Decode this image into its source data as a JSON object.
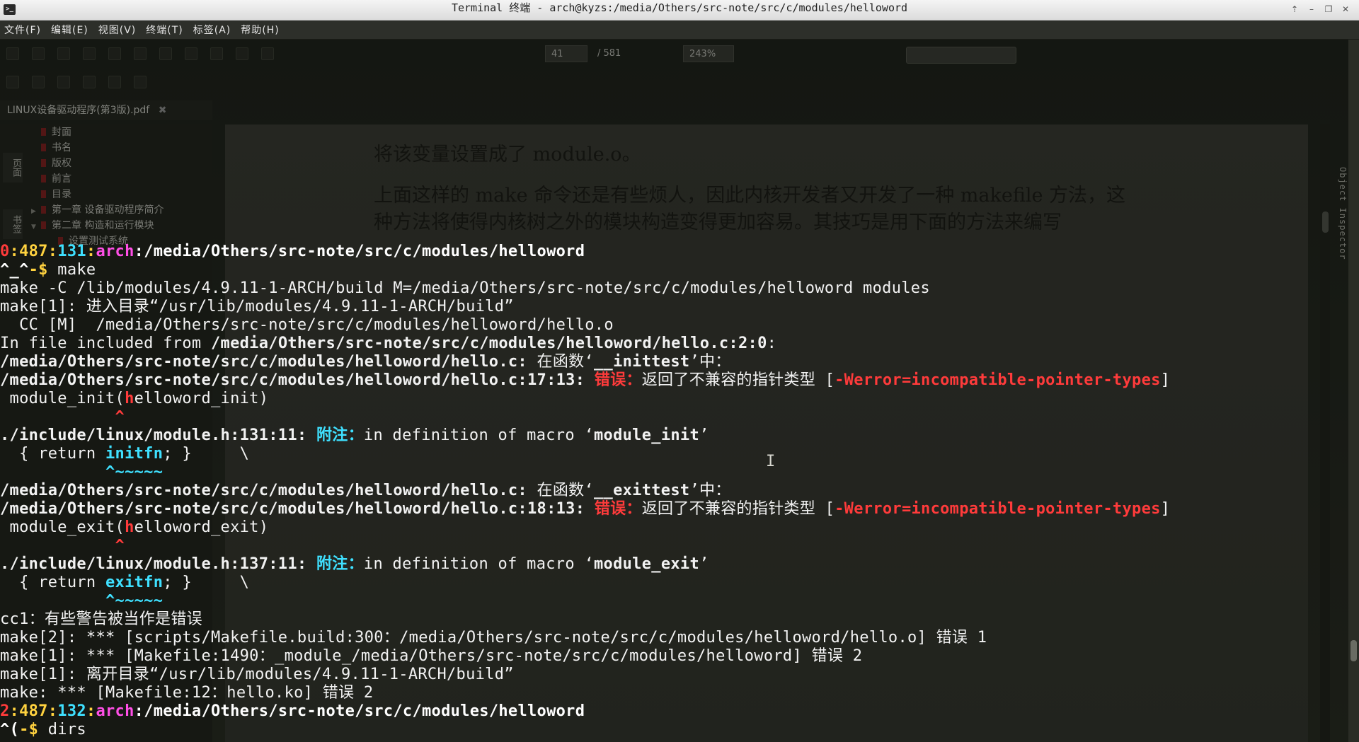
{
  "window": {
    "title": "Terminal 终端 - arch@kyzs:/media/Others/src-note/src/c/modules/helloword",
    "icon": "terminal-icon",
    "icon_glyph": ">_",
    "controls": [
      "up-icon",
      "minimize-icon",
      "maximize-icon",
      "close-icon"
    ]
  },
  "menu": [
    "文件(F)",
    "编辑(E)",
    "视图(V)",
    "终端(T)",
    "标签(A)",
    "帮助(H)"
  ],
  "viewer": {
    "page_current": "41",
    "page_total": "/ 581",
    "zoom": "243%",
    "tab_title": "LINUX设备驱动程序(第3版).pdf",
    "side_tabs": [
      "页面",
      "书签"
    ],
    "toc": [
      {
        "label": "封面",
        "level": 1
      },
      {
        "label": "书名",
        "level": 1
      },
      {
        "label": "版权",
        "level": 1
      },
      {
        "label": "前言",
        "level": 1
      },
      {
        "label": "目录",
        "level": 1
      },
      {
        "label": "第一章  设备驱动程序简介",
        "level": 1,
        "expandable": true
      },
      {
        "label": "第二章  构造和运行模块",
        "level": 1,
        "expanded": true
      },
      {
        "label": "设置测试系统",
        "level": 2
      }
    ],
    "pdf_lines": [
      "将该变量设置成了 module.o。",
      "上面这样的 make 命令还是有些烦人，因此内核开发者又开发了一种 makefile 方法，这",
      "种方法将使得内核树之外的模块构造变得更加容易。其技巧是用下面的方法来编写"
    ],
    "inspector_label": "Object Inspector"
  },
  "terminal": {
    "lines": [
      [
        {
          "t": "0",
          "c": "red",
          "b": true
        },
        {
          "t": ":487:",
          "c": "yellow",
          "b": true
        },
        {
          "t": "131",
          "c": "cyan",
          "b": true
        },
        {
          "t": ":",
          "c": "yellow",
          "b": true
        },
        {
          "t": "arch",
          "c": "magenta",
          "b": true
        },
        {
          "t": ":/media/Others/src-note/src/c/modules/helloword",
          "c": "white",
          "b": true
        }
      ],
      [
        {
          "t": "^_^",
          "c": "white",
          "b": true
        },
        {
          "t": "-$",
          "c": "yellow",
          "b": true
        },
        {
          "t": " make"
        }
      ],
      [
        {
          "t": "make -C /lib/modules/4.9.11-1-ARCH/build M=/media/Others/src-note/src/c/modules/helloword modules"
        }
      ],
      [
        {
          "t": "make[1]: 进入目录“/usr/lib/modules/4.9.11-1-ARCH/build”"
        }
      ],
      [
        {
          "t": "  CC [M]  /media/Others/src-note/src/c/modules/helloword/hello.o"
        }
      ],
      [
        {
          "t": "In file included from "
        },
        {
          "t": "/media/Others/src-note/src/c/modules/helloword/hello.c:2:0",
          "b": true
        },
        {
          "t": ":"
        }
      ],
      [
        {
          "t": "/media/Others/src-note/src/c/modules/helloword/hello.c:",
          "b": true
        },
        {
          "t": " 在函数‘"
        },
        {
          "t": "__inittest",
          "b": true
        },
        {
          "t": "’中："
        }
      ],
      [
        {
          "t": "/media/Others/src-note/src/c/modules/helloword/hello.c:17:13:",
          "b": true
        },
        {
          "t": " "
        },
        {
          "t": "错误：",
          "c": "red",
          "b": true
        },
        {
          "t": "返回了不兼容的指针类型 ["
        },
        {
          "t": "-Werror=incompatible-pointer-types",
          "c": "red",
          "b": true
        },
        {
          "t": "]"
        }
      ],
      [
        {
          "t": " module_init("
        },
        {
          "t": "h",
          "c": "red",
          "b": true
        },
        {
          "t": "elloword_init)"
        }
      ],
      [
        {
          "t": "            "
        },
        {
          "t": "^",
          "c": "red",
          "b": true
        }
      ],
      [
        {
          "t": "./include/linux/module.h:131:11:",
          "b": true
        },
        {
          "t": " "
        },
        {
          "t": "附注：",
          "c": "cyan",
          "b": true
        },
        {
          "t": "in definition of macro ‘"
        },
        {
          "t": "module_init",
          "b": true
        },
        {
          "t": "’"
        }
      ],
      [
        {
          "t": "  { return "
        },
        {
          "t": "initfn",
          "c": "cyan",
          "b": true
        },
        {
          "t": "; }     \\"
        }
      ],
      [
        {
          "t": "           "
        },
        {
          "t": "^~~~~~",
          "c": "cyan",
          "b": true
        }
      ],
      [
        {
          "t": "/media/Others/src-note/src/c/modules/helloword/hello.c:",
          "b": true
        },
        {
          "t": " 在函数‘"
        },
        {
          "t": "__exittest",
          "b": true
        },
        {
          "t": "’中："
        }
      ],
      [
        {
          "t": "/media/Others/src-note/src/c/modules/helloword/hello.c:18:13:",
          "b": true
        },
        {
          "t": " "
        },
        {
          "t": "错误：",
          "c": "red",
          "b": true
        },
        {
          "t": "返回了不兼容的指针类型 ["
        },
        {
          "t": "-Werror=incompatible-pointer-types",
          "c": "red",
          "b": true
        },
        {
          "t": "]"
        }
      ],
      [
        {
          "t": " module_exit("
        },
        {
          "t": "h",
          "c": "red",
          "b": true
        },
        {
          "t": "elloword_exit)"
        }
      ],
      [
        {
          "t": "            "
        },
        {
          "t": "^",
          "c": "red",
          "b": true
        }
      ],
      [
        {
          "t": "./include/linux/module.h:137:11:",
          "b": true
        },
        {
          "t": " "
        },
        {
          "t": "附注：",
          "c": "cyan",
          "b": true
        },
        {
          "t": "in definition of macro ‘"
        },
        {
          "t": "module_exit",
          "b": true
        },
        {
          "t": "’"
        }
      ],
      [
        {
          "t": "  { return "
        },
        {
          "t": "exitfn",
          "c": "cyan",
          "b": true
        },
        {
          "t": "; }     \\"
        }
      ],
      [
        {
          "t": "           "
        },
        {
          "t": "^~~~~~",
          "c": "cyan",
          "b": true
        }
      ],
      [
        {
          "t": "cc1：有些警告被当作是错误"
        }
      ],
      [
        {
          "t": "make[2]: *** [scripts/Makefile.build:300：/media/Others/src-note/src/c/modules/helloword/hello.o] 错误 1"
        }
      ],
      [
        {
          "t": "make[1]: *** [Makefile:1490：_module_/media/Others/src-note/src/c/modules/helloword] 错误 2"
        }
      ],
      [
        {
          "t": "make[1]: 离开目录“/usr/lib/modules/4.9.11-1-ARCH/build”"
        }
      ],
      [
        {
          "t": "make: *** [Makefile:12：hello.ko] 错误 2"
        }
      ],
      [
        {
          "t": "2",
          "c": "red",
          "b": true
        },
        {
          "t": ":487:",
          "c": "yellow",
          "b": true
        },
        {
          "t": "132",
          "c": "cyan",
          "b": true
        },
        {
          "t": ":",
          "c": "yellow",
          "b": true
        },
        {
          "t": "arch",
          "c": "magenta",
          "b": true
        },
        {
          "t": ":/media/Others/src-note/src/c/modules/helloword",
          "c": "white",
          "b": true
        }
      ],
      [
        {
          "t": "^(",
          "c": "white",
          "b": true
        },
        {
          "t": "-$",
          "c": "yellow",
          "b": true
        },
        {
          "t": " dirs"
        }
      ]
    ]
  },
  "colors": {
    "red": "#ff3b3b",
    "yellow": "#ffd23f",
    "cyan": "#3fe0ff",
    "magenta": "#ff4fe6",
    "white": "#ffffff"
  }
}
